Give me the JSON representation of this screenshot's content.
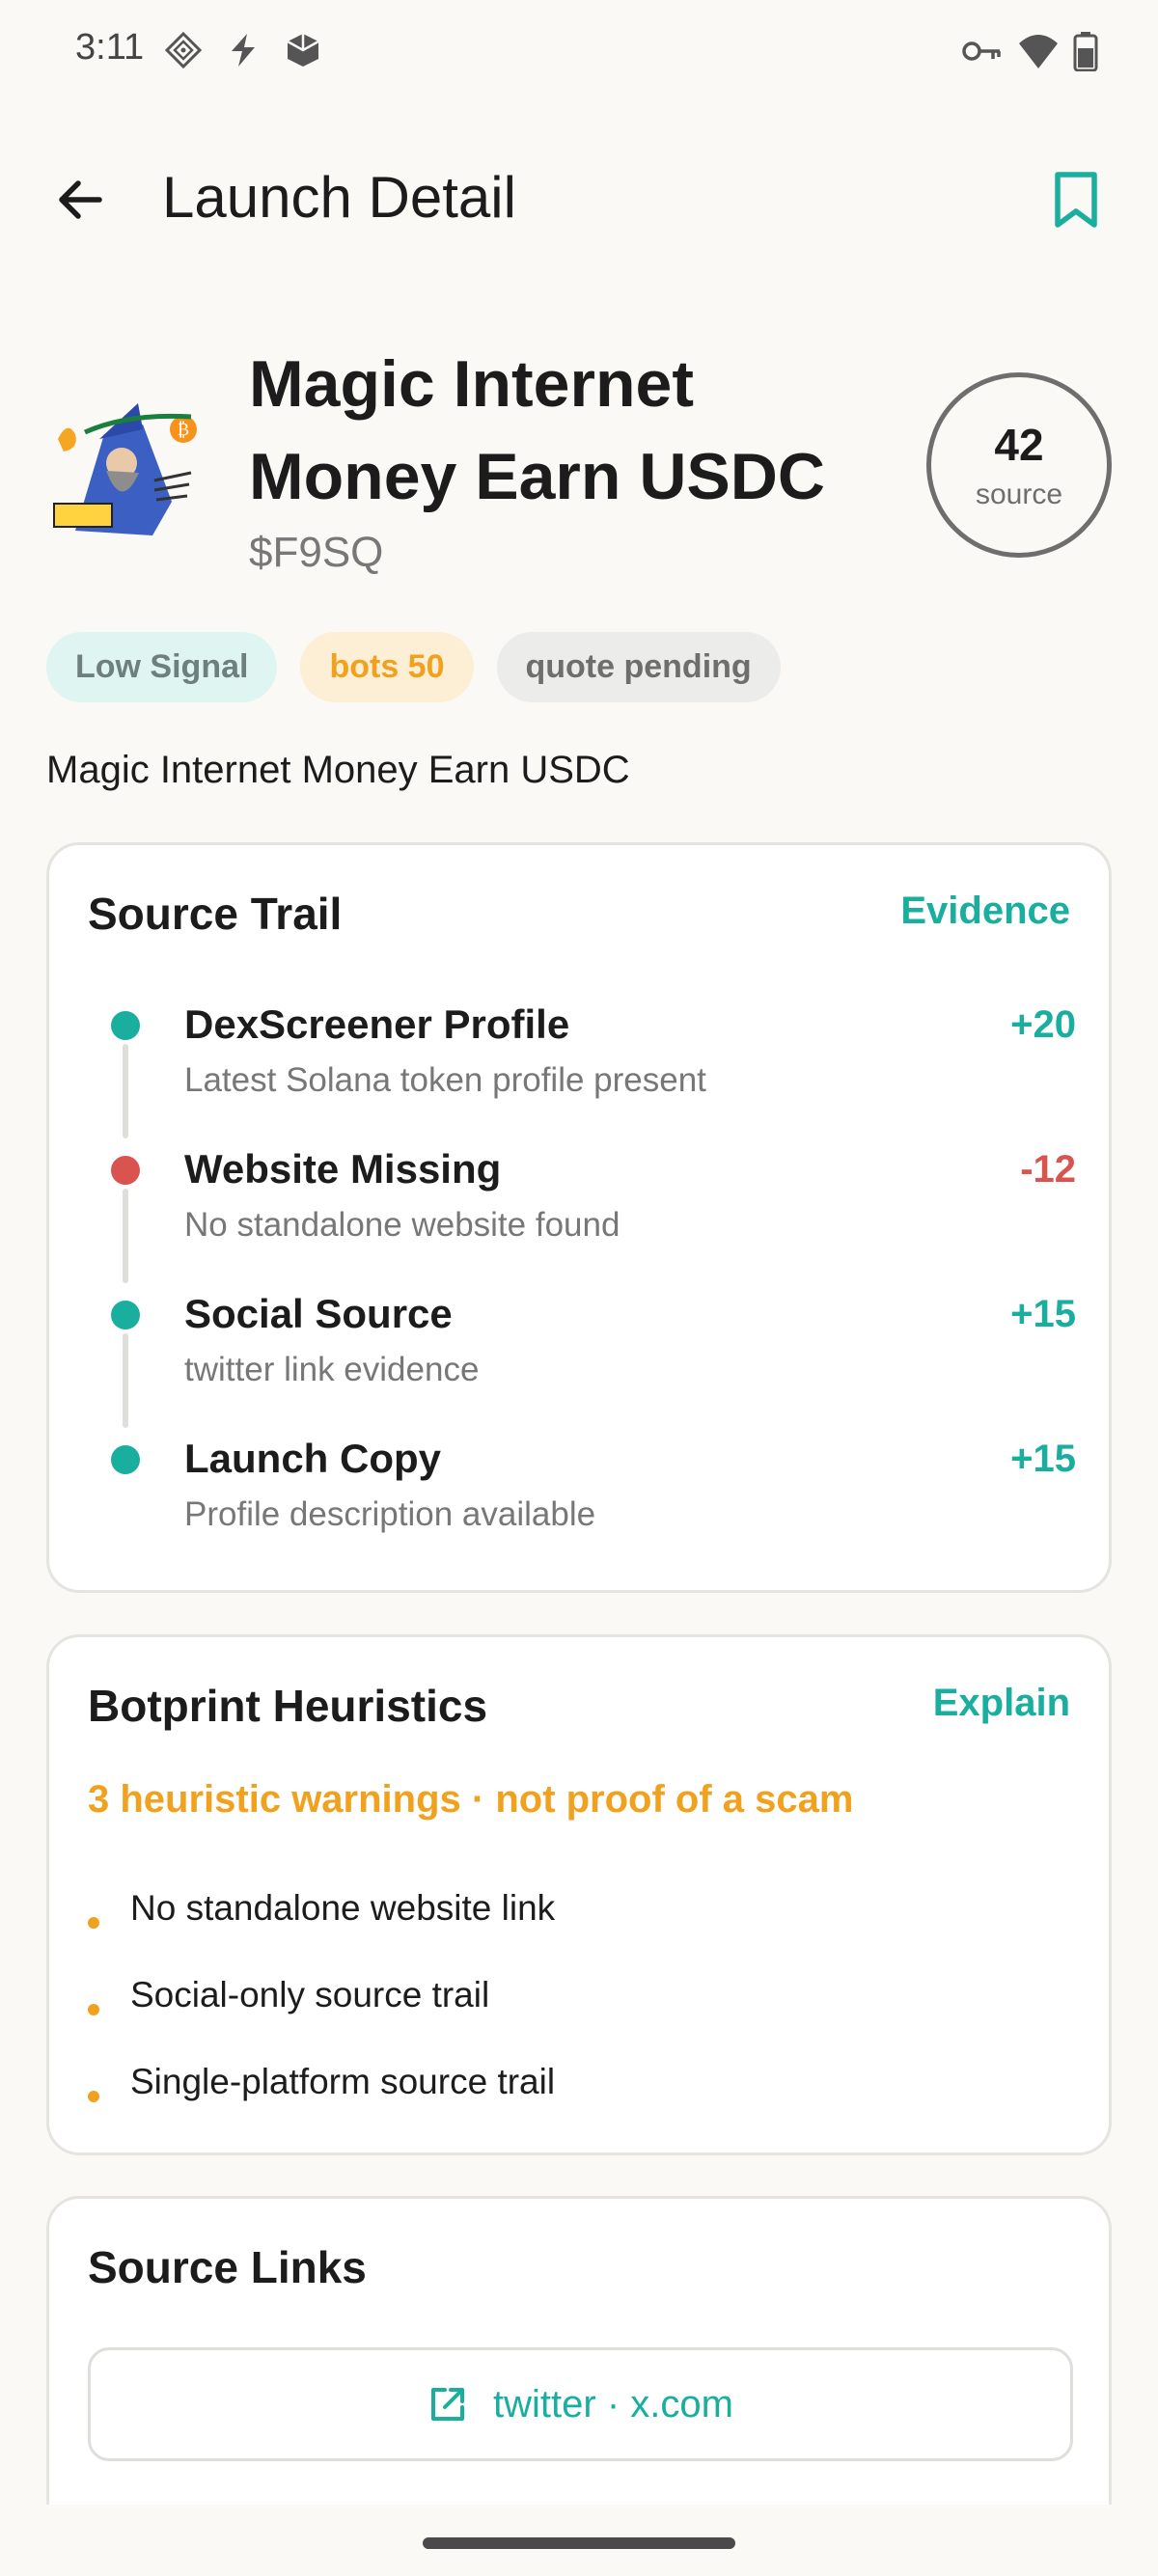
{
  "status_bar": {
    "time": "3:11",
    "left_icons": [
      "diamond-grid-icon",
      "bolt-icon",
      "cube-icon"
    ],
    "right_icons": [
      "vpn-key-icon",
      "wifi-icon",
      "battery-icon"
    ]
  },
  "app_bar": {
    "title": "Launch Detail",
    "back_icon": "arrow-left-icon",
    "bookmark_icon": "bookmark-icon",
    "accent_color": "#1aae9f"
  },
  "token": {
    "name": "Magic Internet Money Earn USDC",
    "symbol": "$F9SQ",
    "logo_icon": "wizard-logo",
    "score": "42",
    "score_label": "source",
    "description": "Magic Internet Money Earn USDC"
  },
  "chips": [
    {
      "label": "Low Signal",
      "color": "#6e7f7c",
      "background": "#dff5f1"
    },
    {
      "label": "bots 50",
      "color": "#f0a21f",
      "background": "#fdeed6"
    },
    {
      "label": "quote pending",
      "color": "#6e6e6e",
      "background": "#ececea"
    }
  ],
  "source_trail": {
    "title": "Source Trail",
    "action": "Evidence",
    "items": [
      {
        "title": "DexScreener Profile",
        "description": "Latest Solana token profile present",
        "score": "+20",
        "status": "positive"
      },
      {
        "title": "Website Missing",
        "description": "No standalone website found",
        "score": "-12",
        "status": "negative"
      },
      {
        "title": "Social Source",
        "description": "twitter link evidence",
        "score": "+15",
        "status": "positive"
      },
      {
        "title": "Launch Copy",
        "description": "Profile description available",
        "score": "+15",
        "status": "positive"
      }
    ],
    "positive_color": "#1aae9f",
    "negative_color": "#d9534f"
  },
  "botprint": {
    "title": "Botprint Heuristics",
    "action": "Explain",
    "warning": "3 heuristic warnings · not proof of a scam",
    "items": [
      "No standalone website link",
      "Social-only source trail",
      "Single-platform source trail"
    ]
  },
  "source_links": {
    "title": "Source Links",
    "links": [
      {
        "label": "twitter · x.com",
        "icon": "open-external-icon"
      }
    ]
  }
}
